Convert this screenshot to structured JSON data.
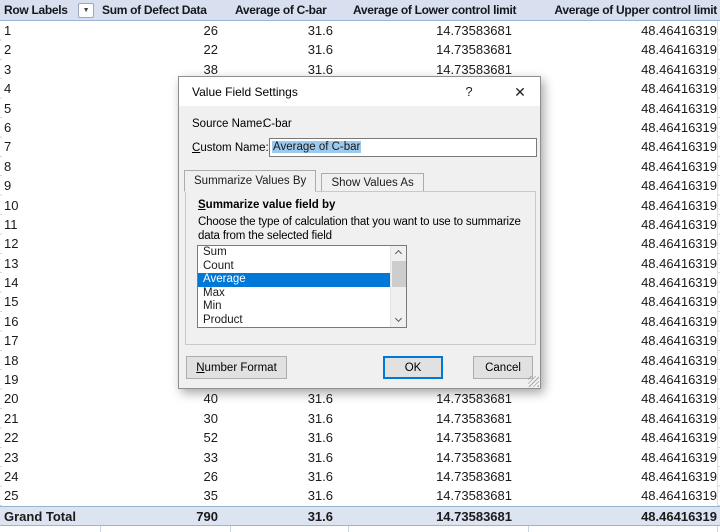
{
  "pivot_table": {
    "headers": [
      "Row Labels",
      "Sum of Defect Data",
      "Average of C-bar",
      "Average of Lower control limit",
      "Average of Upper control limit"
    ],
    "rows": [
      {
        "label": "1",
        "defect": "26",
        "cbar": "31.6",
        "lcl": "14.73583681",
        "ucl": "48.46416319"
      },
      {
        "label": "2",
        "defect": "22",
        "cbar": "31.6",
        "lcl": "14.73583681",
        "ucl": "48.46416319"
      },
      {
        "label": "3",
        "defect": "38",
        "cbar": "31.6",
        "lcl": "14.73583681",
        "ucl": "48.46416319"
      },
      {
        "label": "4",
        "defect": null,
        "cbar": null,
        "lcl": null,
        "ucl": "48.46416319"
      },
      {
        "label": "5",
        "defect": null,
        "cbar": null,
        "lcl": null,
        "ucl": "48.46416319"
      },
      {
        "label": "6",
        "defect": null,
        "cbar": null,
        "lcl": null,
        "ucl": "48.46416319"
      },
      {
        "label": "7",
        "defect": null,
        "cbar": null,
        "lcl": null,
        "ucl": "48.46416319"
      },
      {
        "label": "8",
        "defect": null,
        "cbar": null,
        "lcl": null,
        "ucl": "48.46416319"
      },
      {
        "label": "9",
        "defect": null,
        "cbar": null,
        "lcl": null,
        "ucl": "48.46416319"
      },
      {
        "label": "10",
        "defect": null,
        "cbar": null,
        "lcl": null,
        "ucl": "48.46416319"
      },
      {
        "label": "11",
        "defect": null,
        "cbar": null,
        "lcl": null,
        "ucl": "48.46416319"
      },
      {
        "label": "12",
        "defect": null,
        "cbar": null,
        "lcl": null,
        "ucl": "48.46416319"
      },
      {
        "label": "13",
        "defect": null,
        "cbar": null,
        "lcl": null,
        "ucl": "48.46416319"
      },
      {
        "label": "14",
        "defect": null,
        "cbar": null,
        "lcl": null,
        "ucl": "48.46416319"
      },
      {
        "label": "15",
        "defect": null,
        "cbar": null,
        "lcl": null,
        "ucl": "48.46416319"
      },
      {
        "label": "16",
        "defect": null,
        "cbar": null,
        "lcl": null,
        "ucl": "48.46416319"
      },
      {
        "label": "17",
        "defect": null,
        "cbar": null,
        "lcl": null,
        "ucl": "48.46416319"
      },
      {
        "label": "18",
        "defect": null,
        "cbar": null,
        "lcl": null,
        "ucl": "48.46416319"
      },
      {
        "label": "19",
        "defect": null,
        "cbar": null,
        "lcl": null,
        "ucl": "48.46416319"
      },
      {
        "label": "20",
        "defect": "40",
        "cbar": "31.6",
        "lcl": "14.73583681",
        "ucl": "48.46416319"
      },
      {
        "label": "21",
        "defect": "30",
        "cbar": "31.6",
        "lcl": "14.73583681",
        "ucl": "48.46416319"
      },
      {
        "label": "22",
        "defect": "52",
        "cbar": "31.6",
        "lcl": "14.73583681",
        "ucl": "48.46416319"
      },
      {
        "label": "23",
        "defect": "33",
        "cbar": "31.6",
        "lcl": "14.73583681",
        "ucl": "48.46416319"
      },
      {
        "label": "24",
        "defect": "26",
        "cbar": "31.6",
        "lcl": "14.73583681",
        "ucl": "48.46416319"
      },
      {
        "label": "25",
        "defect": "35",
        "cbar": "31.6",
        "lcl": "14.73583681",
        "ucl": "48.46416319"
      }
    ],
    "grand_total": {
      "label": "Grand Total",
      "defect": "790",
      "cbar": "31.6",
      "lcl": "14.73583681",
      "ucl": "48.46416319"
    }
  },
  "icons": {
    "filter_dropdown": "▼",
    "dialog_help": "?",
    "dialog_close": "✕"
  },
  "dialog": {
    "title": "Value Field Settings",
    "source_name_label": "Source Name:",
    "source_name_value": "C-bar",
    "custom_name_label": "Custom Name:",
    "custom_name_value": "Average of C-bar",
    "tabs": [
      {
        "label": "Summarize Values By"
      },
      {
        "label": "Show Values As"
      }
    ],
    "section_heading": "Summarize value field by",
    "description_line1": "Choose the type of calculation that you want to use to summarize",
    "description_line2": "data from the selected field",
    "list_items": [
      "Sum",
      "Count",
      "Average",
      "Max",
      "Min",
      "Product"
    ],
    "selected_item": "Average",
    "buttons": {
      "number_format": "Number Format",
      "ok": "OK",
      "cancel": "Cancel"
    }
  },
  "colors": {
    "header_bg": "#D8E0EF",
    "total_bg": "#DCE4F2",
    "pivot_border": "#9DB2D9",
    "list_selection": "#0078D7",
    "text_selection": "#9CC9EE",
    "ok_focus_border": "#0078D7",
    "dialog_bg": "#F0F0F0"
  }
}
